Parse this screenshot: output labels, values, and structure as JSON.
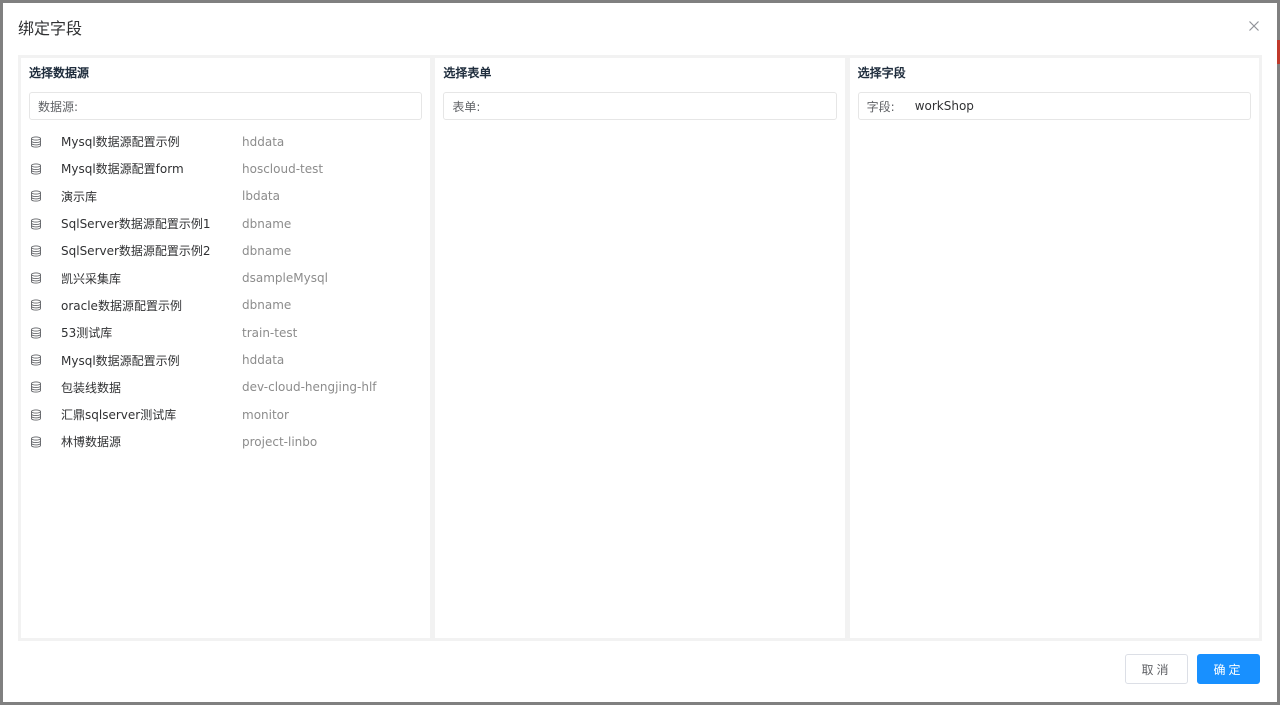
{
  "dialog": {
    "title": "绑定字段",
    "close_icon": "close-icon"
  },
  "panels": {
    "datasource": {
      "title": "选择数据源",
      "search_label": "数据源:",
      "search_value": "",
      "items": [
        {
          "name": "Mysql数据源配置示例",
          "db": "hddata"
        },
        {
          "name": "Mysql数据源配置form",
          "db": "hoscloud-test"
        },
        {
          "name": "演示库",
          "db": "lbdata"
        },
        {
          "name": "SqlServer数据源配置示例1",
          "db": "dbname"
        },
        {
          "name": "SqlServer数据源配置示例2",
          "db": "dbname"
        },
        {
          "name": "凯兴采集库",
          "db": "dsampleMysql"
        },
        {
          "name": "oracle数据源配置示例",
          "db": "dbname"
        },
        {
          "name": "53测试库",
          "db": "train-test"
        },
        {
          "name": "Mysql数据源配置示例",
          "db": "hddata"
        },
        {
          "name": "包装线数据",
          "db": "dev-cloud-hengjing-hlf"
        },
        {
          "name": "汇鼎sqlserver测试库",
          "db": "monitor"
        },
        {
          "name": "林博数据源",
          "db": "project-linbo"
        }
      ]
    },
    "table": {
      "title": "选择表单",
      "search_label": "表单:",
      "search_value": ""
    },
    "field": {
      "title": "选择字段",
      "search_label": "字段:",
      "search_value": "workShop"
    }
  },
  "footer": {
    "cancel_label": "取消",
    "ok_label": "确定"
  },
  "colors": {
    "primary": "#1890ff",
    "panel_bg": "#f2f2f2"
  }
}
